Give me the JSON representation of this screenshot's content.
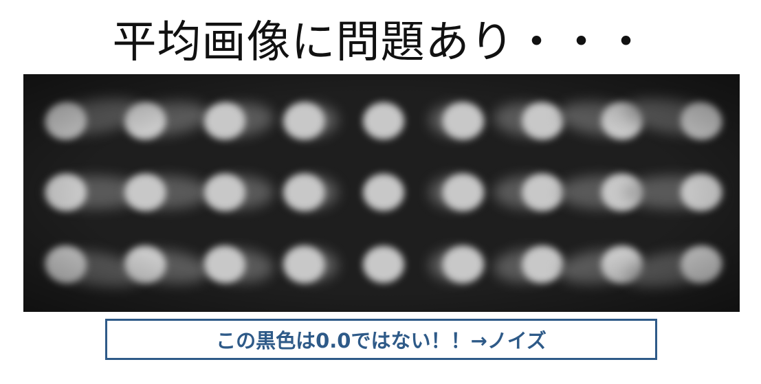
{
  "slide": {
    "title": "平均画像に問題あり・・・",
    "note": "この黒色は0.0ではない！！→ノイズ"
  },
  "image": {
    "description_icon": "averaged-image",
    "background_color": "#1b1b1b",
    "blob_color": "#c8c8c8",
    "rows": 3,
    "columns": 9
  },
  "colors": {
    "title": "#111111",
    "note_border": "#2e5a88",
    "note_text": "#2e5a88"
  }
}
